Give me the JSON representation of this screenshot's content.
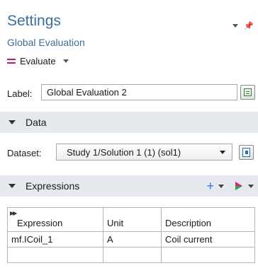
{
  "header": {
    "title": "Settings",
    "subtitle": "Global Evaluation",
    "evaluate_label": "Evaluate"
  },
  "label_row": {
    "label": "Label:",
    "value": "Global Evaluation 2"
  },
  "sections": {
    "data": "Data",
    "expressions": "Expressions"
  },
  "dataset": {
    "label": "Dataset:",
    "selected": "Study 1/Solution 1 (1) (sol1)"
  },
  "table": {
    "headers": [
      "Expression",
      "Unit",
      "Description"
    ],
    "rows": [
      [
        "mf.ICoil_1",
        "A",
        "Coil current"
      ],
      [
        "",
        "",
        ""
      ]
    ]
  },
  "colors": {
    "title_blue": "#3a6f9f",
    "section_bg": "#e6eaef",
    "evaluate_accent": "#b0217a",
    "add_blue": "#2f7ae0"
  },
  "icons": {
    "evaluate": "equals-icon",
    "add": "plus-icon",
    "evaluate_run": "play-arrow-icon"
  }
}
